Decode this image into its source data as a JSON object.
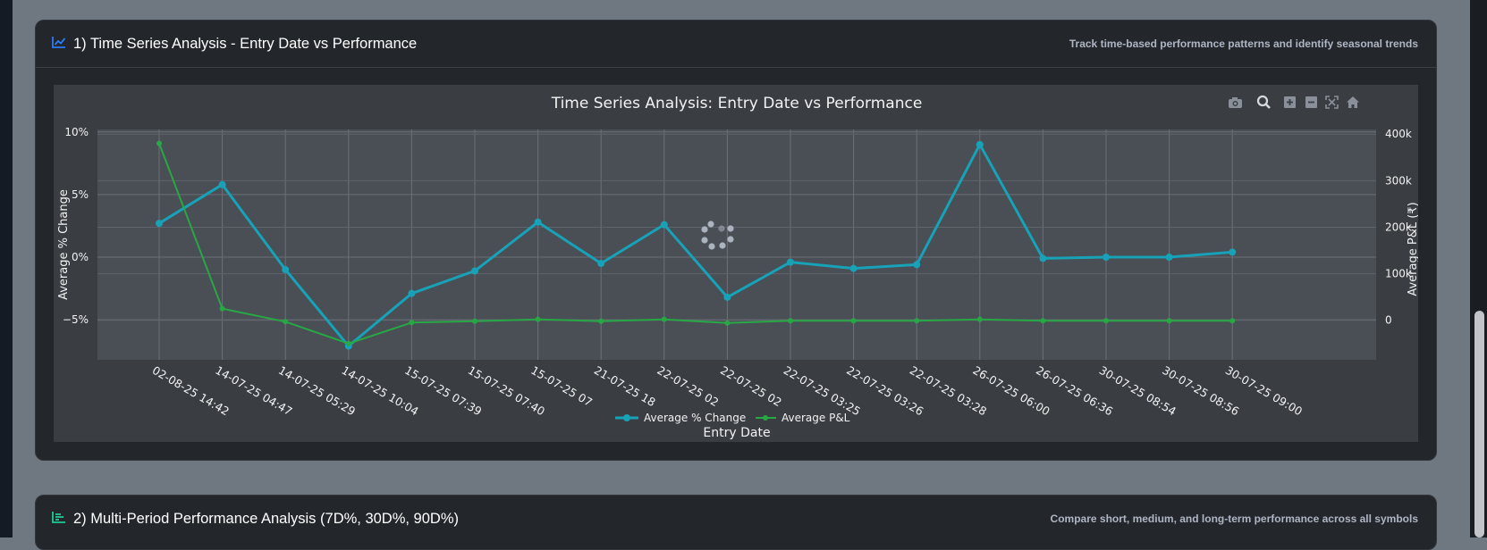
{
  "panel1": {
    "title": "1) Time Series Analysis - Entry Date vs Performance",
    "subtitle": "Track time-based performance patterns and identify seasonal trends"
  },
  "panel2": {
    "title": "2) Multi-Period Performance Analysis (7D%, 30D%, 90D%)",
    "subtitle": "Compare short, medium, and long-term performance across all symbols"
  },
  "toolbar": [
    "camera-icon",
    "zoom-icon",
    "zoom-in-icon",
    "zoom-out-icon",
    "autoscale-icon",
    "home-icon"
  ],
  "colors": {
    "pct_series": "#17a2b8",
    "pnl_series": "#28a745",
    "panel_icon_1": "#2d7cf6",
    "panel_icon_2": "#20c997"
  },
  "chart_data": {
    "type": "line",
    "title": "Time Series Analysis: Entry Date vs Performance",
    "xlabel": "Entry Date",
    "ylabel": "Average % Change",
    "y2label": "Average P&L (₹)",
    "categories": [
      "02-08-25 14:42",
      "14-07-25 04:47",
      "14-07-25 05:29",
      "14-07-25 10:04",
      "15-07-25 07:39",
      "15-07-25 07:40",
      "15-07-25 07",
      "21-07-25 18",
      "22-07-25 02",
      "22-07-25 02",
      "22-07-25 03:25",
      "22-07-25 03:26",
      "22-07-25 03:28",
      "26-07-25 06:00",
      "26-07-25 06:36",
      "30-07-25 08:54",
      "30-07-25 08:56",
      "30-07-25 09:00"
    ],
    "y_ticks": [
      {
        "label": "10%",
        "value": 10
      },
      {
        "label": "5%",
        "value": 5
      },
      {
        "label": "0%",
        "value": 0
      },
      {
        "label": "−5%",
        "value": -5
      }
    ],
    "y2_ticks": [
      {
        "label": "400k",
        "value": 400000
      },
      {
        "label": "300k",
        "value": 300000
      },
      {
        "label": "200k",
        "value": 200000
      },
      {
        "label": "100k",
        "value": 100000
      },
      {
        "label": "0",
        "value": 0
      }
    ],
    "ylim": [
      -8.2,
      10.2
    ],
    "y2lim": [
      -85000,
      410000
    ],
    "legend_position": "bottom",
    "series": [
      {
        "name": "Average % Change",
        "axis": "left",
        "values": [
          2.7,
          5.8,
          -1.0,
          -7.1,
          -2.9,
          -1.1,
          2.8,
          -0.5,
          2.6,
          -3.2,
          -0.4,
          -0.9,
          -0.6,
          9.0,
          -0.1,
          0.0,
          0.0,
          0.4
        ]
      },
      {
        "name": "Average P&L",
        "axis": "right",
        "values": [
          380000,
          25000,
          -3000,
          -50000,
          -5000,
          -2000,
          2000,
          -2000,
          2000,
          -6000,
          -1000,
          -1000,
          -1000,
          2000,
          -1000,
          -1000,
          -1000,
          -1000
        ]
      }
    ]
  }
}
